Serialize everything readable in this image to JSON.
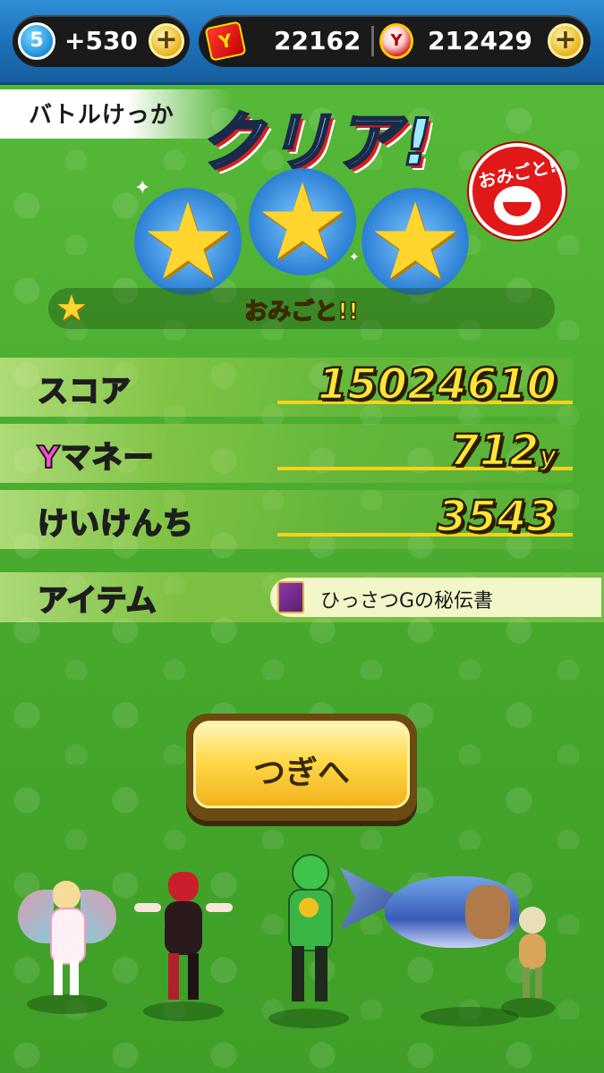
{
  "header": {
    "level": "5",
    "stamina_bonus": "+530",
    "tickets": "22162",
    "money": "212429",
    "plus_symbol": "+",
    "ticket_icon_glyph": "Y",
    "coin_icon_glyph": "Y"
  },
  "result": {
    "label": "バトルけっか",
    "title": "クリア!",
    "stars_earned": 3,
    "stars_total": 3,
    "stamp_text": "おみごと!",
    "rating_text": "おみごと!!"
  },
  "rows": {
    "score_label": "スコア",
    "score_value": "15024610",
    "money_label": "Yマネー",
    "money_value": "712",
    "money_unit": "y",
    "exp_label": "けいけんち",
    "exp_value": "3543",
    "item_label": "アイテム",
    "item_name": "ひっさつGの秘伝書"
  },
  "buttons": {
    "next_label": "つぎへ"
  },
  "colors": {
    "background_green": "#4cae31",
    "topbar_blue": "#1c6fb8",
    "gold_text": "#ffe43a",
    "money_label_pink": "#ff4ad2",
    "item_label_green": "#7dff2a",
    "stamp_red": "#e01818"
  }
}
